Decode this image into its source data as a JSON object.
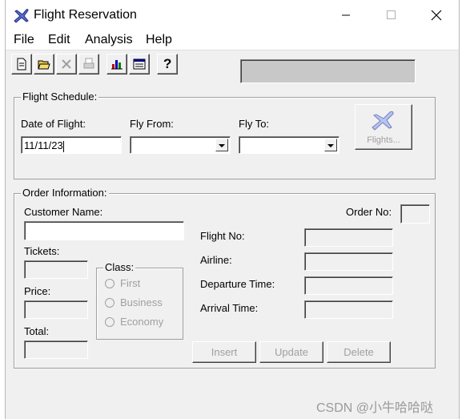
{
  "window": {
    "title": "Flight Reservation"
  },
  "menu": [
    "File",
    "Edit",
    "Analysis",
    "Help"
  ],
  "toolbar": {
    "help_label": "?"
  },
  "flight_schedule": {
    "title": "Flight Schedule:",
    "date_label": "Date of Flight:",
    "date_value": "11/11/23",
    "from_label": "Fly From:",
    "from_value": "",
    "to_label": "Fly To:",
    "to_value": "",
    "flights_button": "Flights..."
  },
  "order": {
    "title": "Order Information:",
    "customer_label": "Customer Name:",
    "customer_value": "",
    "order_no_label": "Order No:",
    "tickets_label": "Tickets:",
    "price_label": "Price:",
    "total_label": "Total:",
    "class_label": "Class:",
    "class_options": [
      "First",
      "Business",
      "Economy"
    ],
    "flight_no_label": "Flight No:",
    "airline_label": "Airline:",
    "departure_label": "Departure Time:",
    "arrival_label": "Arrival Time:",
    "insert_button": "Insert",
    "update_button": "Update",
    "delete_button": "Delete"
  },
  "watermark": "CSDN @小牛哈哈哒"
}
